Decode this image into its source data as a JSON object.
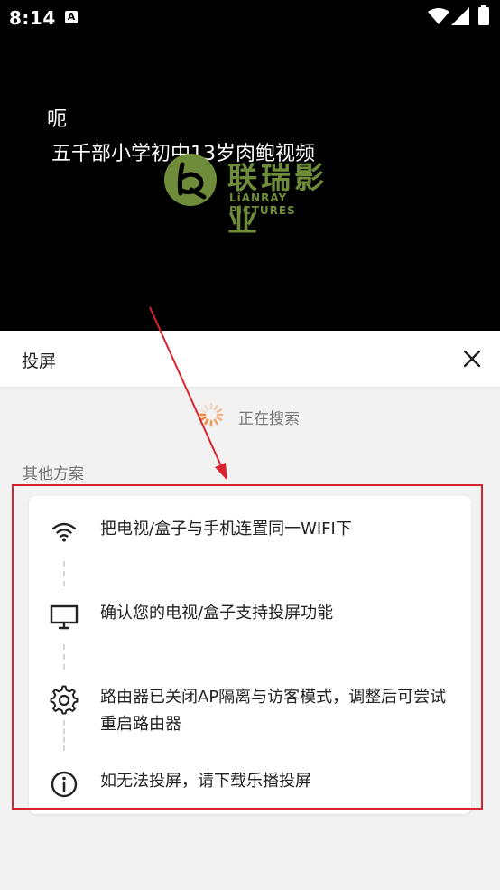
{
  "status_bar": {
    "time": "8:14",
    "notification_icon": "A"
  },
  "video": {
    "caption_line1": "呃",
    "caption_line2": "五千部小学初中13岁肉鲍视频",
    "watermark_cn": "联瑞影业",
    "watermark_en": "LiANRAY PiCTURES"
  },
  "sheet": {
    "title": "投屏",
    "searching_label": "正在搜索",
    "other_solutions_title": "其他方案",
    "steps": [
      {
        "icon": "wifi-icon",
        "text": "把电视/盒子与手机连置同一WIFI下"
      },
      {
        "icon": "monitor-icon",
        "text": "确认您的电视/盒子支持投屏功能"
      },
      {
        "icon": "settings-gear-icon",
        "text": "路由器已关闭AP隔离与访客模式，调整后可尝试重启路由器"
      },
      {
        "icon": "info-icon",
        "text": "如无法投屏，请下载乐播投屏"
      }
    ]
  },
  "colors": {
    "annotation_red": "#d9232e",
    "logo_green": "#6f8c3a"
  }
}
